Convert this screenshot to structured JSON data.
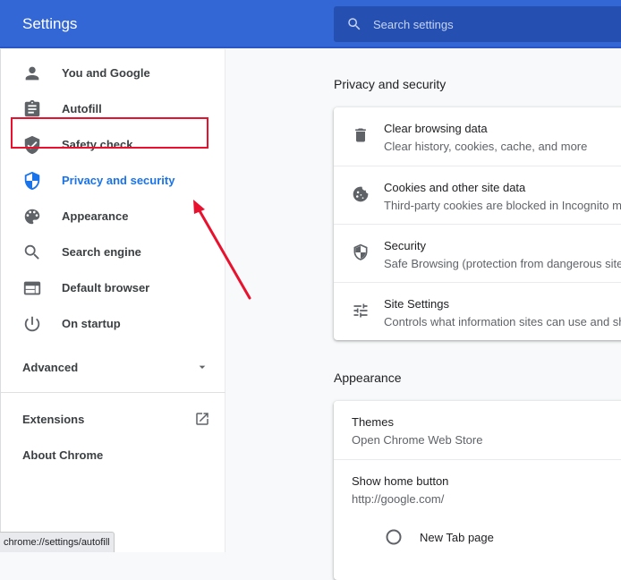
{
  "header": {
    "title": "Settings",
    "search_placeholder": "Search settings"
  },
  "sidebar": {
    "items": [
      {
        "label": "You and Google",
        "icon": "person-icon"
      },
      {
        "label": "Autofill",
        "icon": "clipboard-icon"
      },
      {
        "label": "Safety check",
        "icon": "shield-check-icon"
      },
      {
        "label": "Privacy and security",
        "icon": "shield-icon",
        "active": true
      },
      {
        "label": "Appearance",
        "icon": "palette-icon"
      },
      {
        "label": "Search engine",
        "icon": "search-icon"
      },
      {
        "label": "Default browser",
        "icon": "browser-icon"
      },
      {
        "label": "On startup",
        "icon": "power-icon"
      }
    ],
    "advanced_label": "Advanced",
    "extensions_label": "Extensions",
    "about_label": "About Chrome"
  },
  "privacy": {
    "title": "Privacy and security",
    "rows": [
      {
        "primary": "Clear browsing data",
        "secondary": "Clear history, cookies, cache, and more",
        "icon": "trash-icon"
      },
      {
        "primary": "Cookies and other site data",
        "secondary": "Third-party cookies are blocked in Incognito mode",
        "icon": "cookie-icon"
      },
      {
        "primary": "Security",
        "secondary": "Safe Browsing (protection from dangerous sites)",
        "icon": "shield-icon"
      },
      {
        "primary": "Site Settings",
        "secondary": "Controls what information sites can use and show",
        "icon": "sliders-icon"
      }
    ]
  },
  "appearance": {
    "title": "Appearance",
    "themes_label": "Themes",
    "themes_value": "Open Chrome Web Store",
    "home_label": "Show home button",
    "home_value": "http://google.com/",
    "radio_label": "New Tab page"
  },
  "status_bar": {
    "url": "chrome://settings/autofill"
  },
  "colors": {
    "header": "#3367d6",
    "accent": "#1a73e8",
    "highlight": "#e8112e"
  }
}
